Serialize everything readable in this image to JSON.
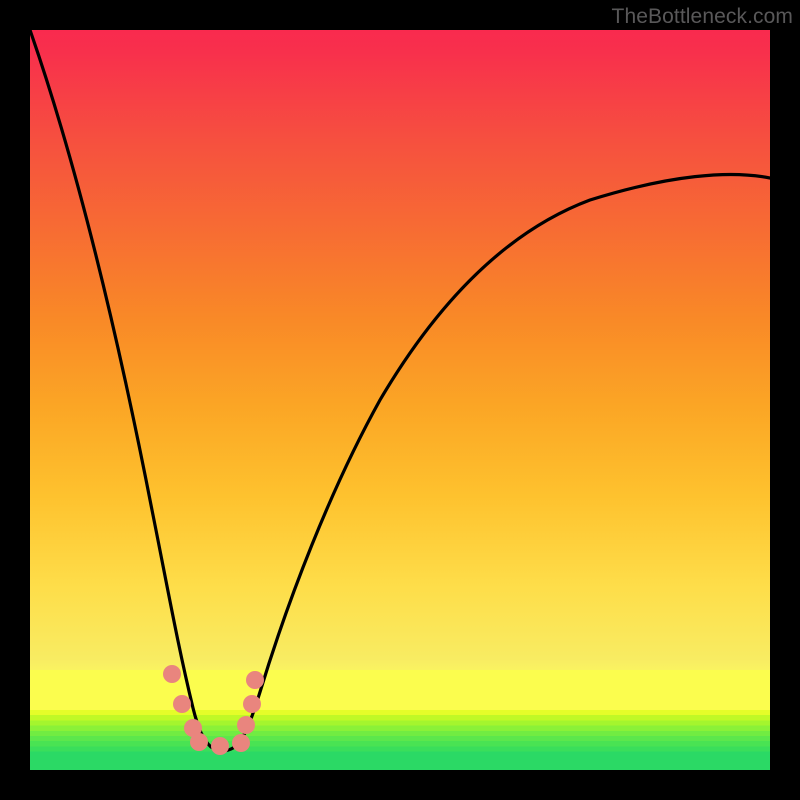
{
  "watermark": {
    "text": "TheBottleneck.com"
  },
  "chart_data": {
    "type": "line",
    "title": "",
    "xlabel": "",
    "ylabel": "",
    "xlim": [
      0,
      100
    ],
    "ylim": [
      0,
      100
    ],
    "series": [
      {
        "name": "bottleneck-curve",
        "x": [
          0,
          5,
          10,
          15,
          18,
          20,
          22,
          24,
          26,
          28,
          30,
          35,
          40,
          45,
          50,
          55,
          60,
          65,
          70,
          75,
          80,
          85,
          90,
          95,
          100
        ],
        "values": [
          100,
          80,
          60,
          40,
          28,
          20,
          12,
          5,
          3,
          3,
          4,
          9,
          18,
          28,
          37,
          45,
          52,
          58,
          63,
          67,
          71,
          74,
          76.5,
          78.5,
          80
        ]
      }
    ],
    "markers": {
      "name": "highlight-region",
      "x": [
        19.2,
        20.6,
        22.2,
        22.8,
        25.8,
        28.6,
        29.2,
        30.0,
        30.4
      ],
      "values": [
        10.0,
        6.5,
        4.5,
        3.2,
        3.0,
        3.2,
        5.2,
        8.0,
        10.5
      ],
      "color": "#E9857E"
    },
    "gradient_bands": [
      {
        "stop": 0.0,
        "color": "#2bd965"
      },
      {
        "stop": 2.5,
        "color": "#2bd965"
      },
      {
        "stop": 13.5,
        "color": "#fbfd4e"
      },
      {
        "stop": 50.0,
        "color": "#fba625"
      },
      {
        "stop": 100.0,
        "color": "#f92a4e"
      }
    ]
  }
}
